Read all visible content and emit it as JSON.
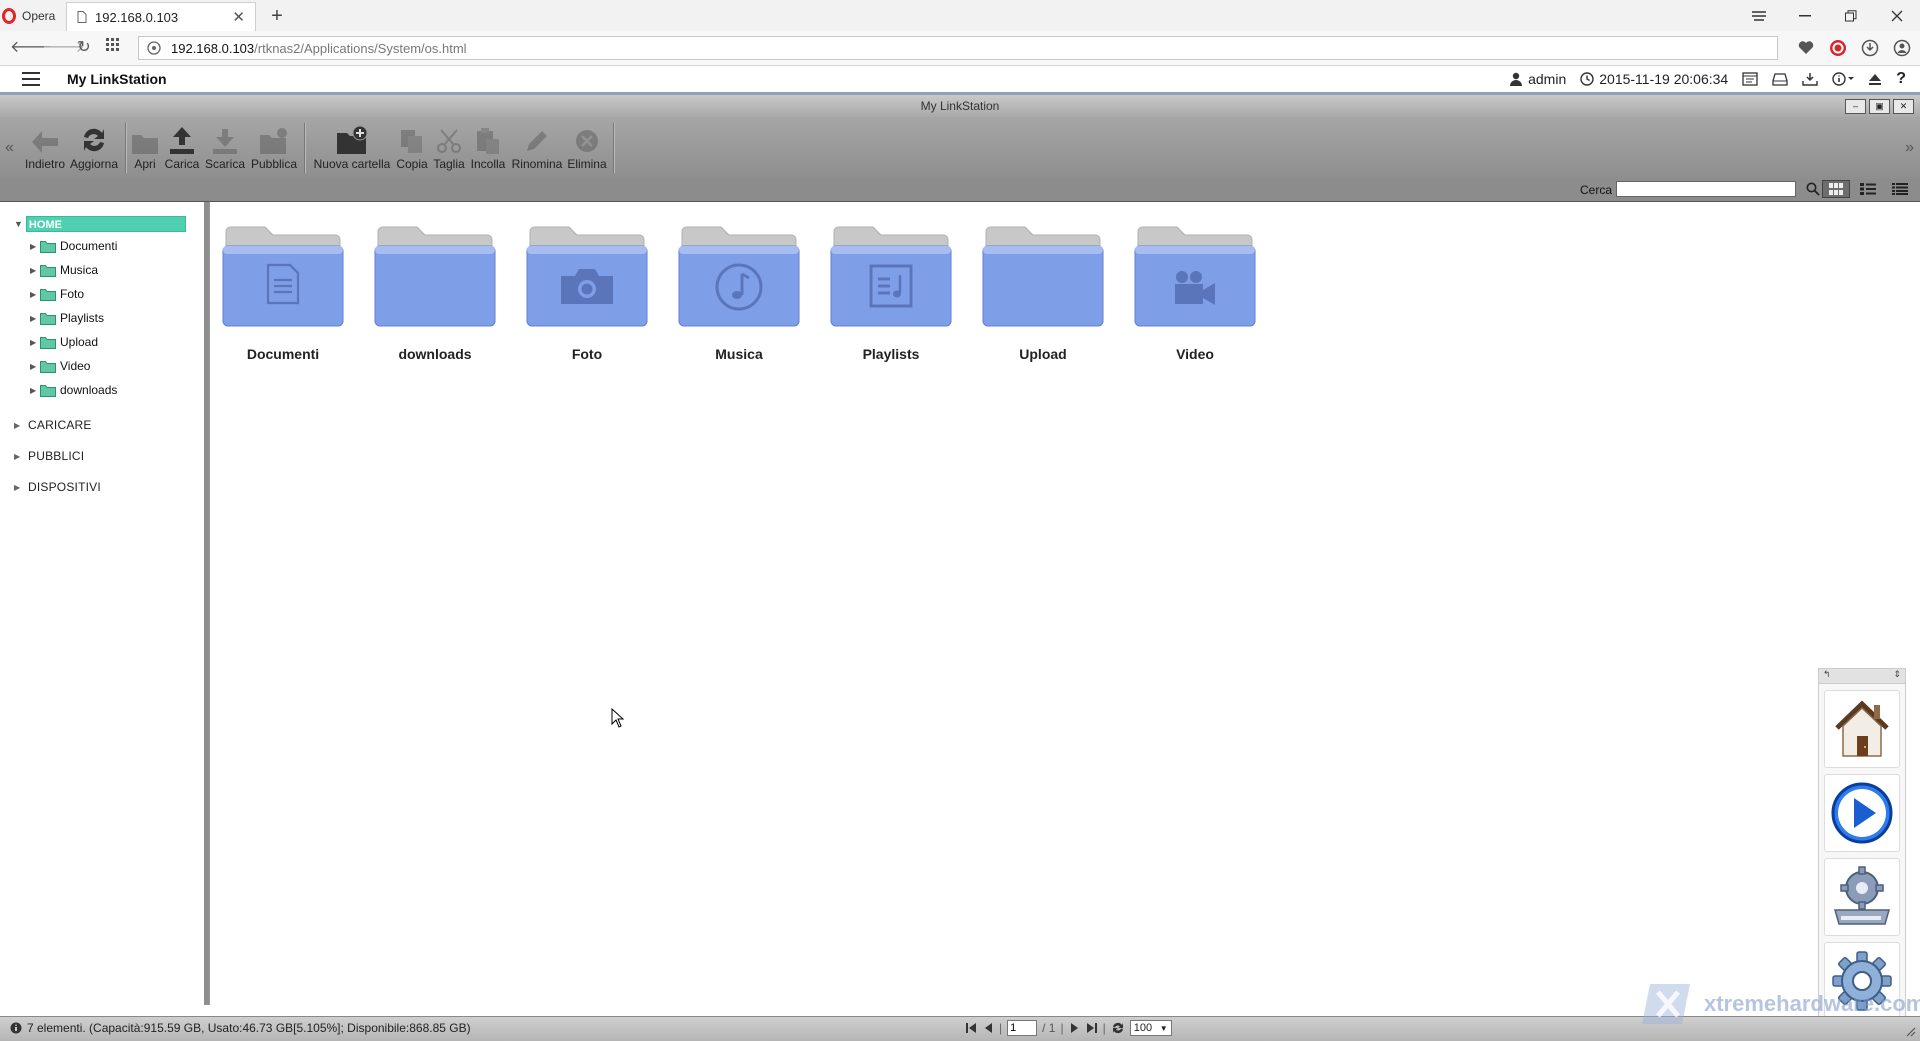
{
  "browser": {
    "menu_label": "Opera",
    "tab_title": "192.168.0.103",
    "address_host": "192.168.0.103",
    "address_path": "/rtknas2/Applications/System/os.html"
  },
  "app": {
    "title": "My LinkStation",
    "user": "admin",
    "datetime": "2015-11-19 20:06:34"
  },
  "window": {
    "title": "My LinkStation"
  },
  "toolbar": {
    "items": [
      {
        "label": "Indietro",
        "icon": "back-arrow-icon",
        "enabled": false
      },
      {
        "label": "Aggiorna",
        "icon": "refresh-icon",
        "enabled": true
      },
      {
        "label": "Apri",
        "icon": "open-folder-icon",
        "enabled": false
      },
      {
        "label": "Carica",
        "icon": "upload-icon",
        "enabled": true
      },
      {
        "label": "Scarica",
        "icon": "download-icon",
        "enabled": false
      },
      {
        "label": "Pubblica",
        "icon": "publish-icon",
        "enabled": false
      },
      {
        "label": "Nuova cartella",
        "icon": "new-folder-icon",
        "enabled": true
      },
      {
        "label": "Copia",
        "icon": "copy-icon",
        "enabled": false
      },
      {
        "label": "Taglia",
        "icon": "scissors-icon",
        "enabled": false
      },
      {
        "label": "Incolla",
        "icon": "paste-icon",
        "enabled": false
      },
      {
        "label": "Rinomina",
        "icon": "pencil-icon",
        "enabled": false
      },
      {
        "label": "Elimina",
        "icon": "delete-icon",
        "enabled": false
      }
    ]
  },
  "search": {
    "label": "Cerca",
    "value": ""
  },
  "sidebar": {
    "home": "HOME",
    "tree": [
      "Documenti",
      "Musica",
      "Foto",
      "Playlists",
      "Upload",
      "Video",
      "downloads"
    ],
    "sections": [
      "CARICARE",
      "PUBBLICI",
      "DISPOSITIVI"
    ]
  },
  "folders": [
    {
      "name": "Documenti",
      "icon": "document-icon"
    },
    {
      "name": "downloads",
      "icon": ""
    },
    {
      "name": "Foto",
      "icon": "camera-icon"
    },
    {
      "name": "Musica",
      "icon": "music-note-icon"
    },
    {
      "name": "Playlists",
      "icon": "playlist-icon"
    },
    {
      "name": "Upload",
      "icon": ""
    },
    {
      "name": "Video",
      "icon": "video-camera-icon"
    }
  ],
  "status": {
    "text": "7 elementi. (Capacità:915.59 GB, Usato:46.73 GB[5.105%]; Disponibile:868.85 GB)",
    "page": "1",
    "page_total": "/ 1",
    "page_size": "100"
  },
  "watermark": "xtremehardware.com",
  "colors": {
    "home_highlight": "#4fd0b0",
    "folder_blue": "#7f9ee8",
    "header_border": "#8ca3bb"
  }
}
